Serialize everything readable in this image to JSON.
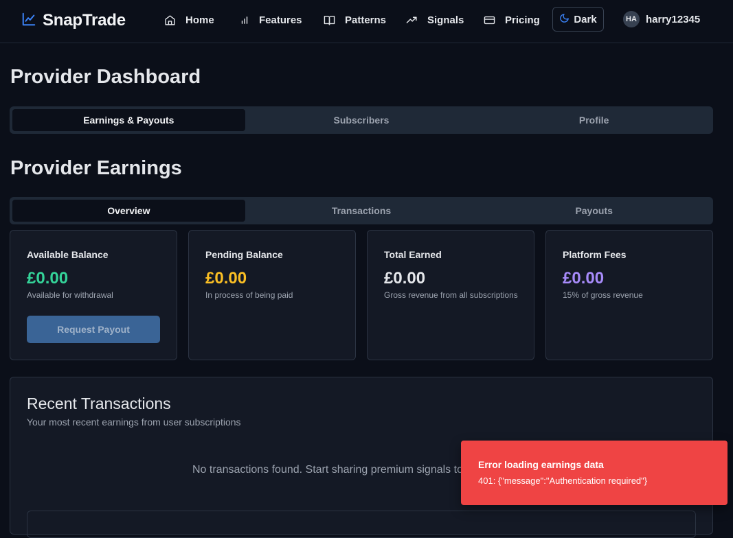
{
  "brand": {
    "name": "SnapTrade",
    "icon": "line-chart-icon",
    "accent": "#3b82f6"
  },
  "nav": {
    "items": [
      {
        "label": "Home",
        "icon": "home-icon"
      },
      {
        "label": "Features",
        "icon": "bar-chart-icon"
      },
      {
        "label": "Patterns",
        "icon": "book-open-icon"
      },
      {
        "label": "Signals",
        "icon": "trending-up-icon"
      },
      {
        "label": "Pricing",
        "icon": "credit-card-icon"
      }
    ],
    "theme_label": "Dark",
    "user": {
      "initials": "HA",
      "name": "harry12345"
    }
  },
  "page": {
    "title": "Provider Dashboard",
    "tabs": [
      "Earnings & Payouts",
      "Subscribers",
      "Profile"
    ],
    "active_tab": "Earnings & Payouts"
  },
  "earnings": {
    "title": "Provider Earnings",
    "tabs": [
      "Overview",
      "Transactions",
      "Payouts"
    ],
    "active_tab": "Overview",
    "cards": [
      {
        "title": "Available Balance",
        "value": "£0.00",
        "sub": "Available for withdrawal",
        "color": "#34d399"
      },
      {
        "title": "Pending Balance",
        "value": "£0.00",
        "sub": "In process of being paid",
        "color": "#fbbf24"
      },
      {
        "title": "Total Earned",
        "value": "£0.00",
        "sub": "Gross revenue from all subscriptions",
        "color": "#e5e7eb"
      },
      {
        "title": "Platform Fees",
        "value": "£0.00",
        "sub": "15% of gross revenue",
        "color": "#a78bfa"
      }
    ],
    "payout_button": "Request Payout"
  },
  "transactions": {
    "title": "Recent Transactions",
    "subtitle": "Your most recent earnings from user subscriptions",
    "empty": "No transactions found. Start sharing premium signals to earn!"
  },
  "toast": {
    "title": "Error loading earnings data",
    "message": "401: {\"message\":\"Authentication required\"}",
    "color": "#ef4444"
  }
}
